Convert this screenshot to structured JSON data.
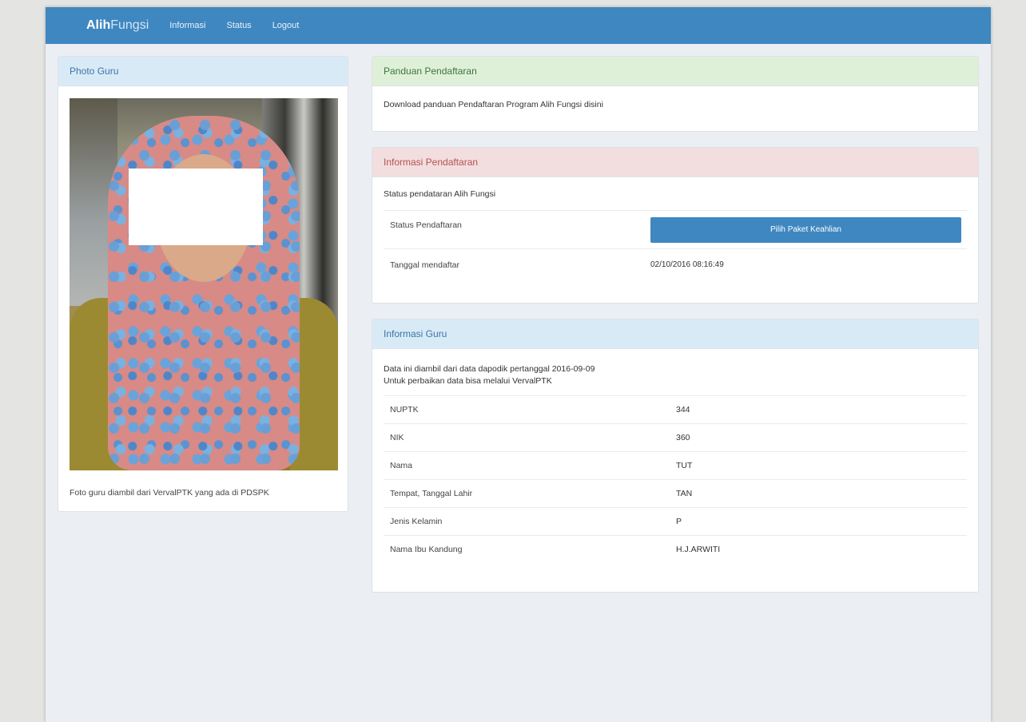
{
  "navbar": {
    "brand_bold": "Alih",
    "brand_light": "Fungsi",
    "links": [
      "Informasi",
      "Status",
      "Logout"
    ]
  },
  "photo_panel": {
    "title": "Photo Guru",
    "caption": "Foto guru diambil dari VervalPTK yang ada di PDSPK"
  },
  "panduan": {
    "title": "Panduan Pendaftaran",
    "text": "Download panduan Pendaftaran Program Alih Fungsi disini"
  },
  "informasi_pendaftaran": {
    "title": "Informasi Pendaftaran",
    "subtitle": "Status pendataran Alih Fungsi",
    "status_label": "Status Pendaftaran",
    "status_button": "Pilih Paket Keahlian",
    "tanggal_label": "Tanggal mendaftar",
    "tanggal_value": "02/10/2016 08:16:49"
  },
  "informasi_guru": {
    "title": "Informasi Guru",
    "note_line1": "Data ini diambil dari data dapodik pertanggal 2016-09-09",
    "note_line2": "Untuk perbaikan data bisa melalui VervalPTK",
    "rows": [
      {
        "label": "NUPTK",
        "value": "344"
      },
      {
        "label": "NIK",
        "value": "360"
      },
      {
        "label": "Nama",
        "value": "TUT"
      },
      {
        "label": "Tempat, Tanggal Lahir",
        "value": "TAN"
      },
      {
        "label": "Jenis Kelamin",
        "value": "P"
      },
      {
        "label": "Nama Ibu Kandung",
        "value": "H.J.ARWITI"
      }
    ]
  },
  "colors": {
    "navbar": "#3f87c0",
    "panel_blue": "#d9eaf7",
    "panel_green": "#dff0d8",
    "panel_red": "#f2dede",
    "button_primary": "#3f87c0"
  }
}
